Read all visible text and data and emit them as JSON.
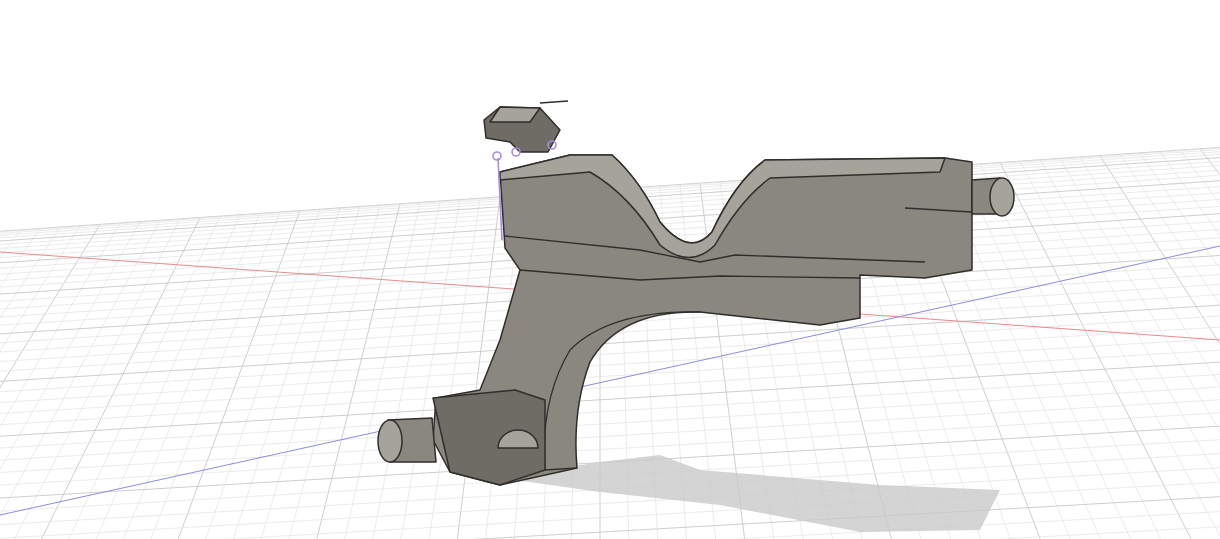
{
  "viewport": {
    "grid": true,
    "axes": true,
    "shadow": true,
    "sketch": true
  }
}
